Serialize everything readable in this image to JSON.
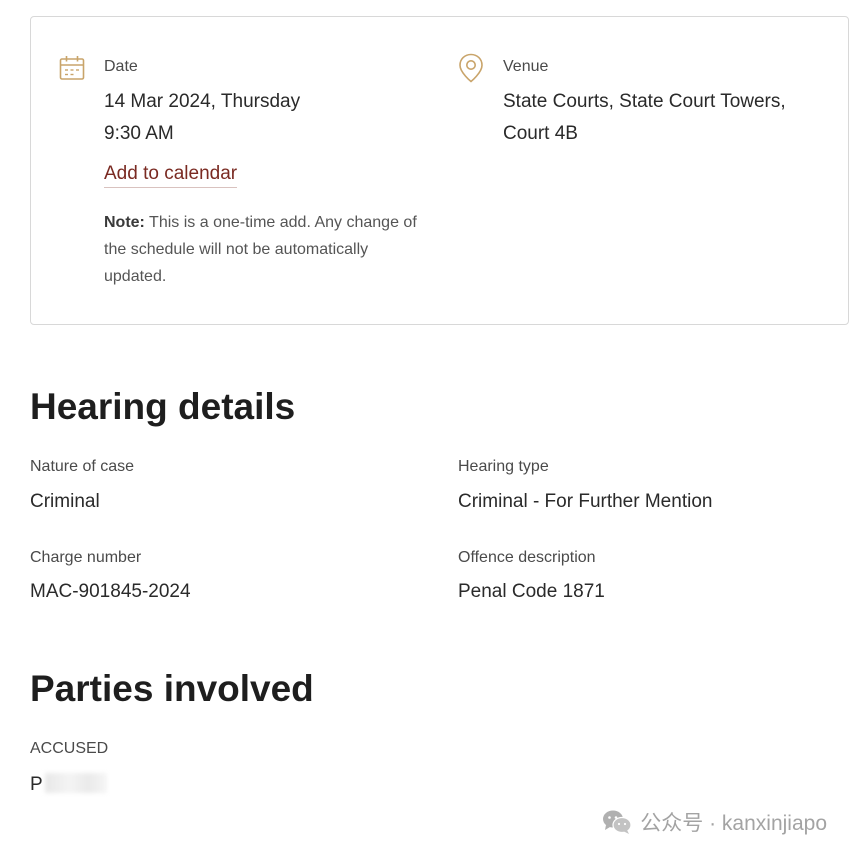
{
  "schedule": {
    "date_label": "Date",
    "date_value": "14 Mar 2024, Thursday",
    "time_value": "9:30 AM",
    "add_calendar_label": "Add to calendar",
    "note_prefix": "Note:",
    "note_text": " This is a one-time add. Any change of the schedule will not be automatically updated.",
    "venue_label": "Venue",
    "venue_line1": "State Courts, State Court Towers,",
    "venue_line2": "Court 4B"
  },
  "hearing_details": {
    "title": "Hearing details",
    "nature_label": "Nature of case",
    "nature_value": "Criminal",
    "hearing_type_label": "Hearing type",
    "hearing_type_value": "Criminal - For Further Mention",
    "charge_label": "Charge number",
    "charge_value": "MAC-901845-2024",
    "offence_label": "Offence description",
    "offence_value": "Penal Code 1871"
  },
  "parties": {
    "title": "Parties involved",
    "accused_label": "ACCUSED",
    "accused_initial": "P"
  },
  "watermark": {
    "text": "公众号 · kanxinjiapo",
    "icon": "wechat-icon"
  },
  "colors": {
    "icon_accent": "#c9a46a",
    "link": "#7a2a22"
  }
}
